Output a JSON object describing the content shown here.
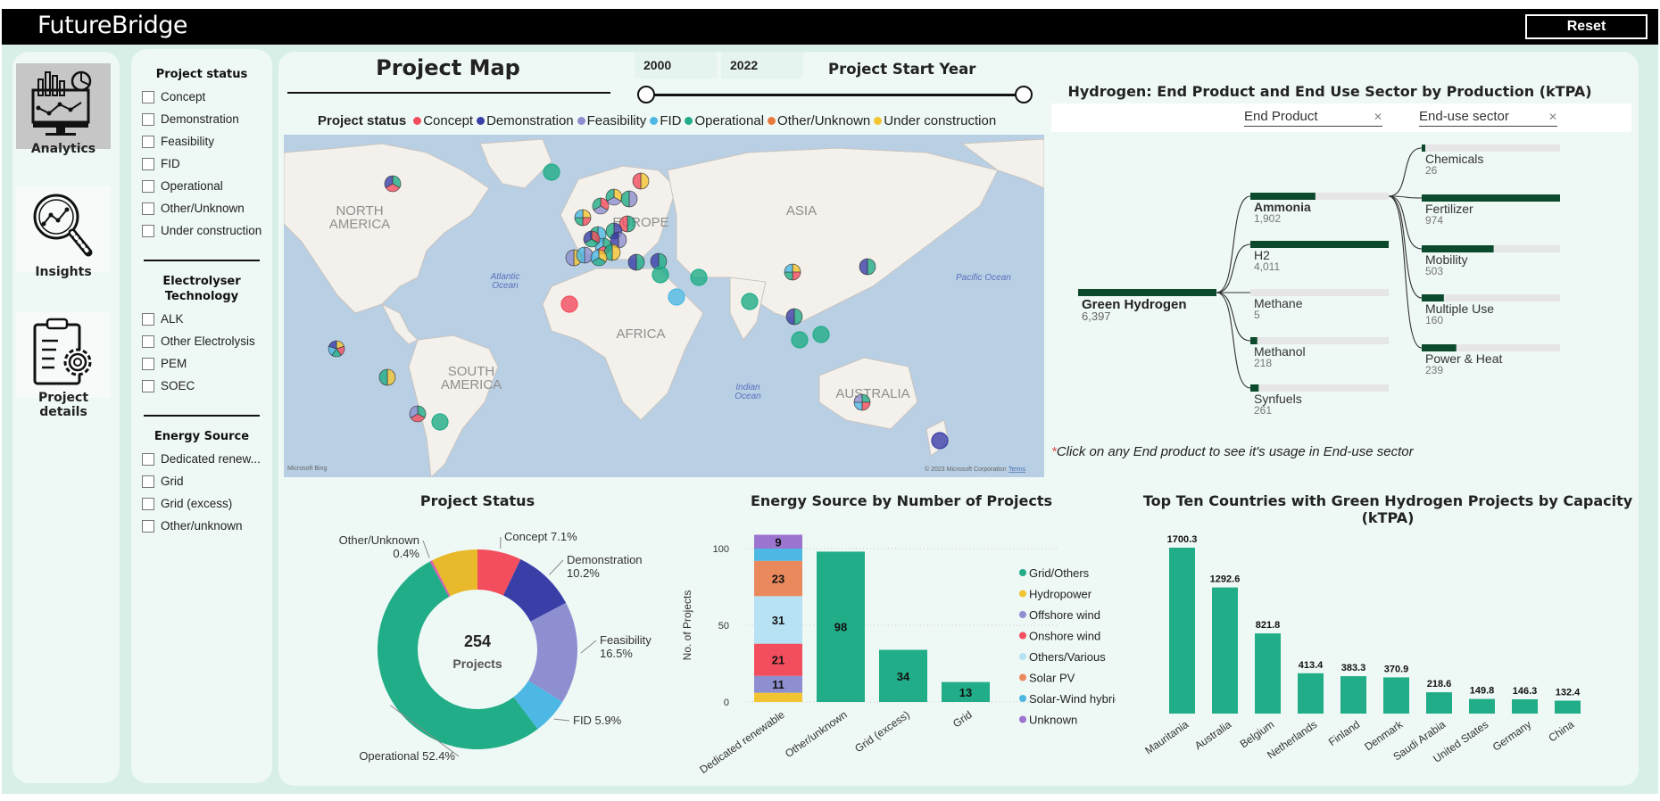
{
  "app": {
    "brand": "FutureBridge",
    "reset_label": "Reset"
  },
  "nav": {
    "items": [
      {
        "label": "Analytics",
        "icon": "analytics-monitor-icon",
        "active": true
      },
      {
        "label": "Insights",
        "icon": "magnifier-chart-icon",
        "active": false
      },
      {
        "label": "Project details",
        "icon": "clipboard-gear-icon",
        "active": false
      }
    ]
  },
  "filters": {
    "project_status": {
      "title": "Project status",
      "options": [
        "Concept",
        "Demonstration",
        "Feasibility",
        "FID",
        "Operational",
        "Other/Unknown",
        "Under construction"
      ]
    },
    "electrolyser": {
      "title_line1": "Electrolyser",
      "title_line2": "Technology",
      "options": [
        "ALK",
        "Other Electrolysis",
        "PEM",
        "SOEC"
      ]
    },
    "energy_source": {
      "title": "Energy Source",
      "options": [
        "Dedicated renew...",
        "Grid",
        "Grid (excess)",
        "Other/unknown"
      ]
    }
  },
  "map": {
    "title": "Project Map",
    "slider": {
      "label": "Project Start Year",
      "start": "2000",
      "end": "2022",
      "min": 2000,
      "max": 2022
    },
    "legend_label": "Project status",
    "legend": [
      {
        "name": "Concept",
        "color": "#f24e5e"
      },
      {
        "name": "Demonstration",
        "color": "#3a3fa8"
      },
      {
        "name": "Feasibility",
        "color": "#8d8fd0"
      },
      {
        "name": "FID",
        "color": "#4cb8e3"
      },
      {
        "name": "Operational",
        "color": "#21ad87"
      },
      {
        "name": "Other/Unknown",
        "color": "#ea7a3c"
      },
      {
        "name": "Under construction",
        "color": "#f3c431"
      }
    ],
    "labels": {
      "north_america": "NORTH AMERICA",
      "south_america": "SOUTH AMERICA",
      "europe": "EUROPE",
      "africa": "AFRICA",
      "asia": "ASIA",
      "australia": "AUSTRALIA",
      "atlantic": "Atlantic Ocean",
      "indian": "Indian Ocean",
      "pacific": "Pacific Ocean"
    },
    "attribution": "© 2023 Microsoft Corporation",
    "terms": "Terms",
    "bing": "Microsoft Bing"
  },
  "decomposition": {
    "title": "Hydrogen: End Product and End Use Sector by Production (kTPA)",
    "level1_header": "End Product",
    "level2_header": "End-use sector",
    "root": {
      "name": "Green Hydrogen",
      "value": "6,397"
    },
    "end_products": [
      {
        "name": "Ammonia",
        "value": "1,902",
        "fraction": 0.47,
        "selected": true
      },
      {
        "name": "H2",
        "value": "4,011",
        "fraction": 1.0
      },
      {
        "name": "Methane",
        "value": "5",
        "fraction": 0.0
      },
      {
        "name": "Methanol",
        "value": "218",
        "fraction": 0.05
      },
      {
        "name": "Synfuels",
        "value": "261",
        "fraction": 0.06
      }
    ],
    "end_use": [
      {
        "name": "Chemicals",
        "value": "26",
        "fraction": 0.02
      },
      {
        "name": "Fertilizer",
        "value": "974",
        "fraction": 1.0
      },
      {
        "name": "Mobility",
        "value": "503",
        "fraction": 0.52
      },
      {
        "name": "Multiple Use",
        "value": "160",
        "fraction": 0.16
      },
      {
        "name": "Power & Heat",
        "value": "239",
        "fraction": 0.25
      }
    ],
    "note_star": "*",
    "note": "Click on any End product to see it's usage in End-use sector"
  },
  "chart_data": [
    {
      "type": "pie",
      "title": "Project Status",
      "center_value": "254",
      "center_label": "Projects",
      "slices": [
        {
          "name": "Concept",
          "value": 7.1,
          "label": "Concept 7.1%",
          "color": "#f24e5e"
        },
        {
          "name": "Demonstration",
          "value": 10.2,
          "label": "Demonstration 10.2%",
          "color": "#3a3fa8"
        },
        {
          "name": "Feasibility",
          "value": 16.5,
          "label": "Feasibility 16.5%",
          "color": "#8d8fd0"
        },
        {
          "name": "FID",
          "value": 5.9,
          "label": "FID 5.9%",
          "color": "#4cb8e3"
        },
        {
          "name": "Operational",
          "value": 52.4,
          "label": "Operational 52.4%",
          "color": "#21ad87"
        },
        {
          "name": "Other/Unknown",
          "value": 0.4,
          "label": "Other/Unknown 0.4%",
          "color": "#d65db1"
        },
        {
          "name": "Under construction",
          "value": 7.5,
          "label": "",
          "color": "#e8b92a"
        }
      ]
    },
    {
      "type": "bar",
      "stacked": true,
      "title": "Energy Source by Number of Projects",
      "xlabel": "",
      "ylabel": "No. of Projects",
      "ylim": [
        0,
        110
      ],
      "yticks": [
        0,
        50,
        100
      ],
      "categories": [
        "Dedicated renewable",
        "Other/unknown",
        "Grid (excess)",
        "Grid"
      ],
      "series": [
        {
          "name": "Hydropower",
          "color": "#f3c431",
          "values": [
            6,
            0,
            0,
            0
          ],
          "show_label": false
        },
        {
          "name": "Offshore wind",
          "color": "#8d8fd0",
          "values": [
            11,
            0,
            0,
            0
          ],
          "show_label": true
        },
        {
          "name": "Onshore wind",
          "color": "#f24e5e",
          "values": [
            21,
            0,
            0,
            0
          ],
          "show_label": true
        },
        {
          "name": "Others/Various",
          "color": "#b6e2f4",
          "values": [
            31,
            0,
            0,
            0
          ],
          "show_label": true
        },
        {
          "name": "Solar PV",
          "color": "#ea8a5c",
          "values": [
            23,
            0,
            0,
            0
          ],
          "show_label": true
        },
        {
          "name": "Solar-Wind hybrid",
          "color": "#4cb8e3",
          "values": [
            8,
            0,
            0,
            0
          ],
          "show_label": false
        },
        {
          "name": "Unknown",
          "color": "#9b74cf",
          "values": [
            9,
            0,
            0,
            0
          ],
          "show_label": true
        },
        {
          "name": "Grid/Others",
          "color": "#21ad87",
          "values": [
            0,
            98,
            34,
            13
          ],
          "show_label": true
        }
      ],
      "legend": [
        "Grid/Others",
        "Hydropower",
        "Offshore wind",
        "Onshore wind",
        "Others/Various",
        "Solar PV",
        "Solar-Wind hybrid",
        "Unknown"
      ],
      "legend_position": "right"
    },
    {
      "type": "bar",
      "title": "Top Ten Countries with Green Hydrogen Projects by Capacity (kTPA)",
      "categories": [
        "Mauritania",
        "Australia",
        "Belgium",
        "Netherlands",
        "Finland",
        "Denmark",
        "Saudi Arabia",
        "United States",
        "Germany",
        "China"
      ],
      "values": [
        1700.3,
        1292.6,
        821.8,
        413.4,
        383.3,
        370.9,
        218.6,
        149.8,
        146.3,
        132.4
      ],
      "labels": [
        "1700.3",
        "1292.6",
        "821.8",
        "413.4",
        "383.3",
        "370.9",
        "218.6",
        "149.8",
        "146.3",
        "132.4"
      ],
      "color": "#21ad87",
      "xlabel": "",
      "ylabel": "",
      "ylim": [
        0,
        1700.3
      ]
    }
  ]
}
